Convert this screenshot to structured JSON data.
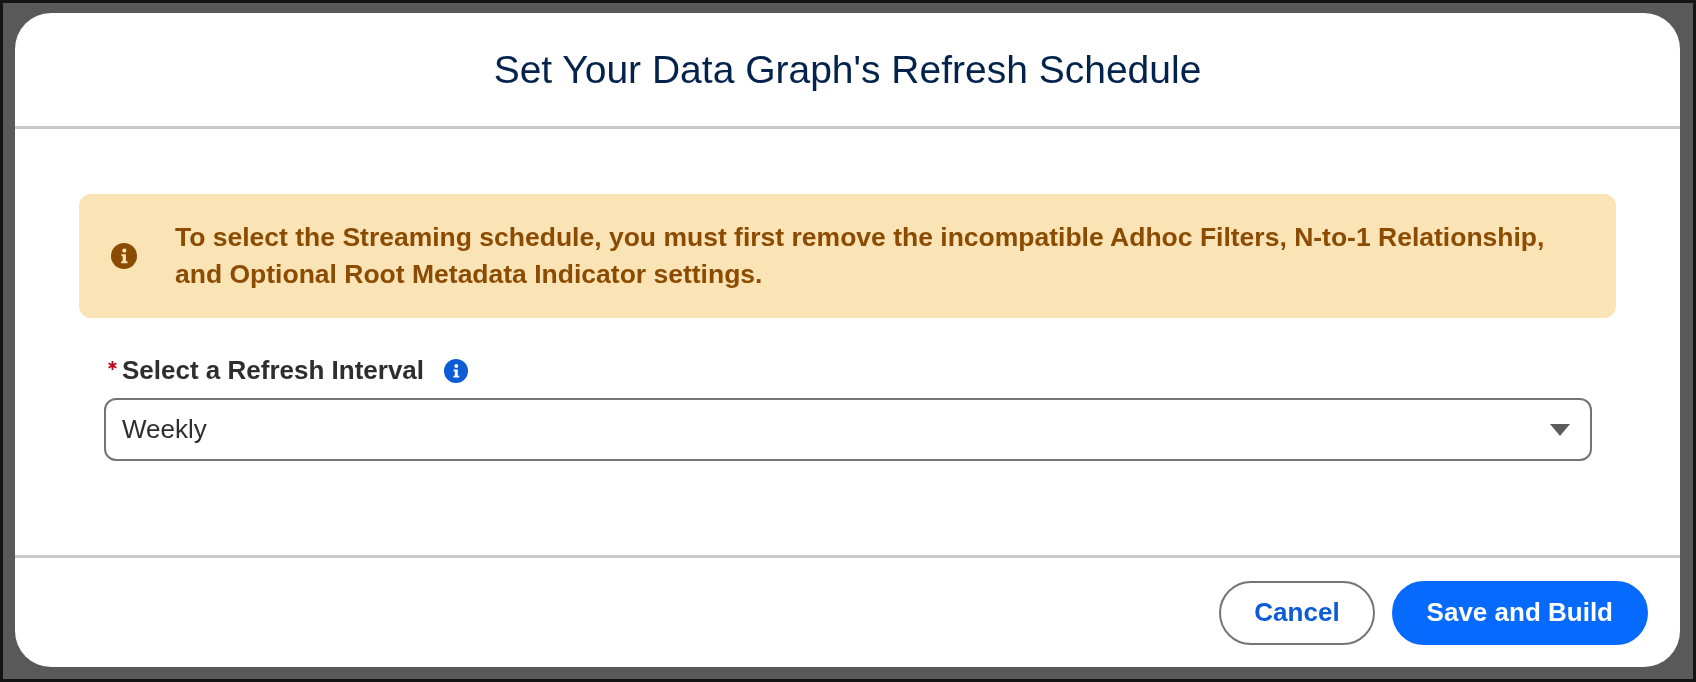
{
  "dialog": {
    "title": "Set Your Data Graph's Refresh Schedule"
  },
  "alert": {
    "kind": "warning",
    "message": "To select the Streaming schedule, you must first remove the incompatible Adhoc Filters, N-to-1 Relationship, and Optional Root Metadata Indicator settings."
  },
  "field": {
    "label": "Select a Refresh Interval",
    "required": true,
    "value": "Weekly"
  },
  "buttons": [
    {
      "label": "Cancel",
      "kind": "neutral"
    },
    {
      "label": "Save and Build",
      "kind": "brand"
    }
  ]
}
